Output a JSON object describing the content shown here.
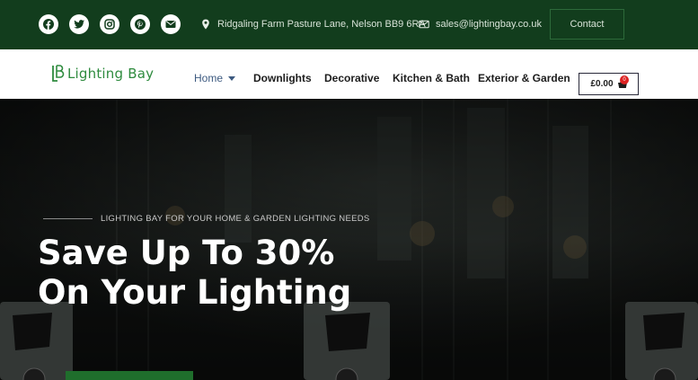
{
  "topbar": {
    "social": [
      {
        "name": "facebook-icon"
      },
      {
        "name": "twitter-icon"
      },
      {
        "name": "instagram-icon"
      },
      {
        "name": "pinterest-icon"
      },
      {
        "name": "envelope-icon"
      }
    ],
    "address": "Ridgaling Farm Pasture Lane, Nelson BB9 6RA",
    "email": "sales@lightingbay.co.uk",
    "contact_label": "Contact"
  },
  "navbar": {
    "logo_text": "Lighting Bay",
    "items": [
      {
        "label": "Home"
      },
      {
        "label": "Downlights"
      },
      {
        "label": "Decorative"
      },
      {
        "label": "Kitchen & Bath"
      },
      {
        "label": "Exterior & Garden"
      }
    ],
    "cart_total": "£0.00",
    "cart_count": "0"
  },
  "hero": {
    "eyebrow": "LIGHTING BAY FOR YOUR HOME & GARDEN LIGHTING NEEDS",
    "headline_line1": "Save Up To 30%",
    "headline_line2": "On Your Lighting"
  },
  "colors": {
    "brand_green": "#123d1d",
    "logo_green": "#2e8b3e",
    "active_nav": "#3d5a80",
    "badge_red": "#dd2222"
  }
}
